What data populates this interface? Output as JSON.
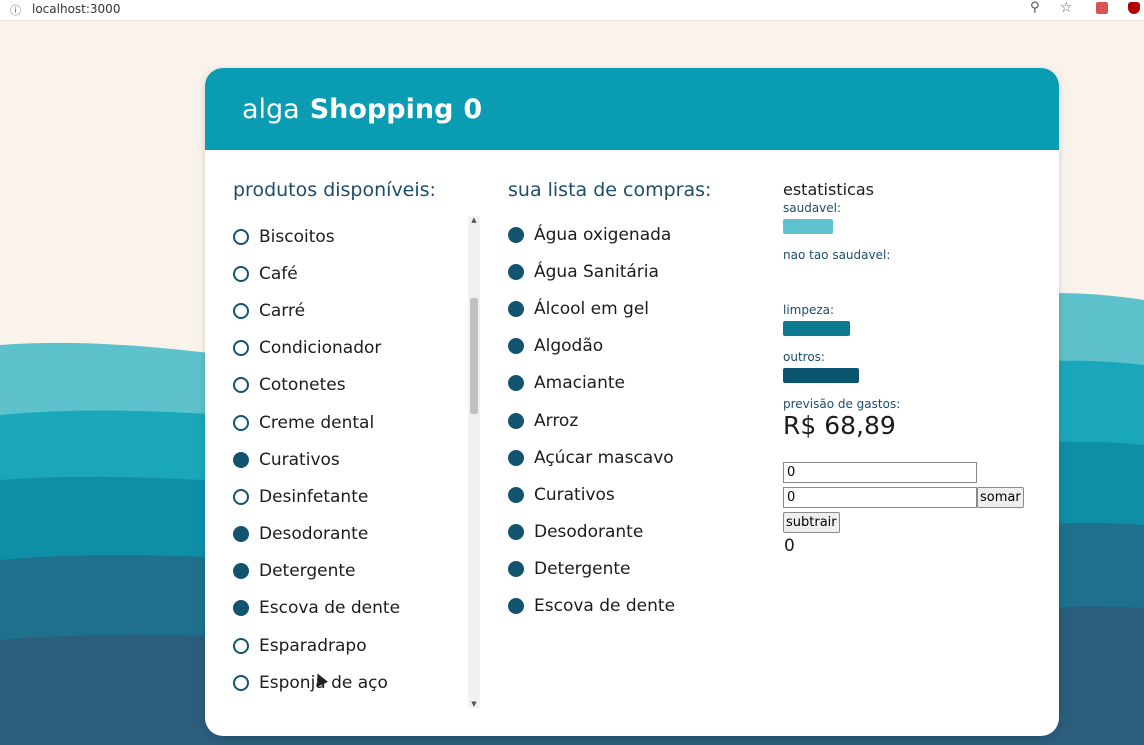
{
  "browser": {
    "url": "localhost:3000"
  },
  "header": {
    "brand": "alga",
    "title": "Shopping",
    "count": "0"
  },
  "colors": {
    "header_bg": "#0a9cb2",
    "accent": "#125470",
    "saudavel": "#5fc3cf",
    "limpeza": "#0b7a90",
    "outros": "#0a5470"
  },
  "available": {
    "title": "produtos disponíveis:",
    "items": [
      {
        "label": "Biscoitos",
        "checked": false
      },
      {
        "label": "Café",
        "checked": false
      },
      {
        "label": "Carré",
        "checked": false
      },
      {
        "label": "Condicionador",
        "checked": false
      },
      {
        "label": "Cotonetes",
        "checked": false
      },
      {
        "label": "Creme dental",
        "checked": false
      },
      {
        "label": "Curativos",
        "checked": true
      },
      {
        "label": "Desinfetante",
        "checked": false
      },
      {
        "label": "Desodorante",
        "checked": true
      },
      {
        "label": "Detergente",
        "checked": true
      },
      {
        "label": "Escova de dente",
        "checked": true
      },
      {
        "label": "Esparadrapo",
        "checked": false
      },
      {
        "label": "Esponja de aço",
        "checked": false
      }
    ]
  },
  "shopping": {
    "title": "sua lista de compras:",
    "items": [
      {
        "label": "Água oxigenada"
      },
      {
        "label": "Água Sanitária"
      },
      {
        "label": "Álcool em gel"
      },
      {
        "label": "Algodão"
      },
      {
        "label": "Amaciante"
      },
      {
        "label": "Arroz"
      },
      {
        "label": "Açúcar mascavo"
      },
      {
        "label": "Curativos"
      },
      {
        "label": "Desodorante"
      },
      {
        "label": "Detergente"
      },
      {
        "label": "Escova de dente"
      }
    ]
  },
  "stats": {
    "title": "estatisticas",
    "saudavel_label": "saudavel:",
    "saudavel_fraction": 0.27,
    "nao_saudavel_label": "nao tao saudavel:",
    "nao_saudavel_fraction": 0,
    "limpeza_label": "limpeza:",
    "limpeza_fraction": 0.36,
    "outros_label": "outros:",
    "outros_fraction": 0.41,
    "previsao_label": "previsão de gastos:",
    "previsao_value": "R$ 68,89"
  },
  "calc": {
    "input1_value": "0",
    "input2_value": "0",
    "somar_label": "somar",
    "subtrair_label": "subtrair",
    "result": "0"
  }
}
